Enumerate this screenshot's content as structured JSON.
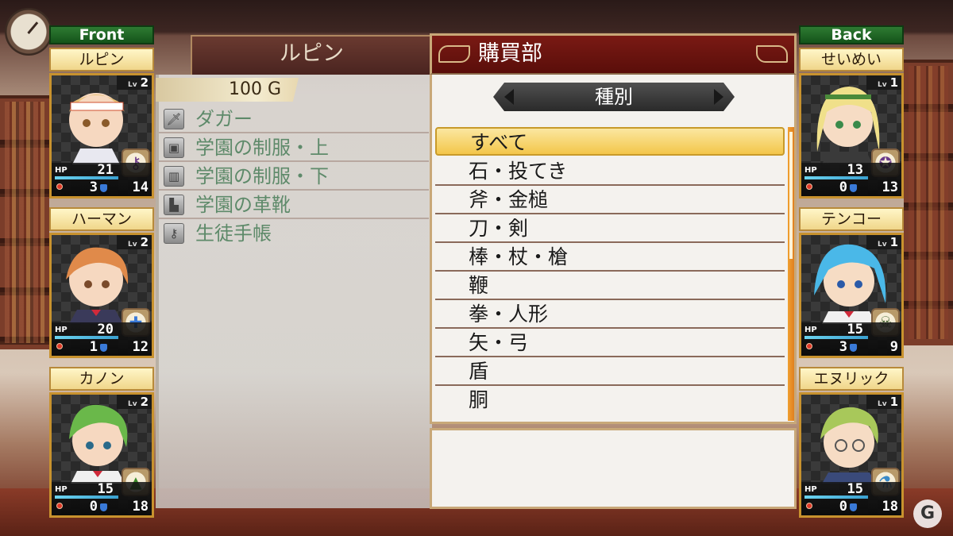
{
  "front_column": {
    "label": "Front",
    "members": [
      {
        "name": "ルピン",
        "level": "2",
        "hp": "21",
        "hp_fraction": 1.0,
        "red_stat": "3",
        "blue_stat": "14",
        "class_icon": "key-icon"
      },
      {
        "name": "ハーマン",
        "level": "2",
        "hp": "20",
        "hp_fraction": 1.0,
        "red_stat": "1",
        "blue_stat": "12",
        "class_icon": "cross-icon"
      },
      {
        "name": "カノン",
        "level": "2",
        "hp": "15",
        "hp_fraction": 1.0,
        "red_stat": "0",
        "blue_stat": "18",
        "class_icon": "witch-hat-icon"
      }
    ]
  },
  "back_column": {
    "label": "Back",
    "members": [
      {
        "name": "せいめい",
        "level": "1",
        "hp": "13",
        "hp_fraction": 1.0,
        "red_stat": "0",
        "blue_stat": "13",
        "class_icon": "pentagram-icon"
      },
      {
        "name": "テンコー",
        "level": "1",
        "hp": "15",
        "hp_fraction": 1.0,
        "red_stat": "3",
        "blue_stat": "9",
        "class_icon": "skull-icon"
      },
      {
        "name": "エヌリック",
        "level": "1",
        "hp": "15",
        "hp_fraction": 1.0,
        "red_stat": "0",
        "blue_stat": "18",
        "class_icon": "flask-icon"
      }
    ]
  },
  "level_label": "Lv",
  "hp_label": "HP",
  "inventory": {
    "owner": "ルピン",
    "money": "100 G",
    "items": [
      {
        "label": "ダガー",
        "icon": "dagger-icon"
      },
      {
        "label": "学園の制服・上",
        "icon": "armor-icon"
      },
      {
        "label": "学園の制服・下",
        "icon": "pants-icon"
      },
      {
        "label": "学園の革靴",
        "icon": "boots-icon"
      },
      {
        "label": "生徒手帳",
        "icon": "key-icon"
      }
    ]
  },
  "shop": {
    "title": "購買部",
    "category_header": "種別",
    "selected_index": 0,
    "categories": [
      "すべて",
      "石・投てき",
      "斧・金槌",
      "刀・剣",
      "棒・杖・槍",
      "鞭",
      "拳・人形",
      "矢・弓",
      "盾",
      "胴"
    ],
    "scroll_fraction": 0.43
  },
  "watermark": "G"
}
